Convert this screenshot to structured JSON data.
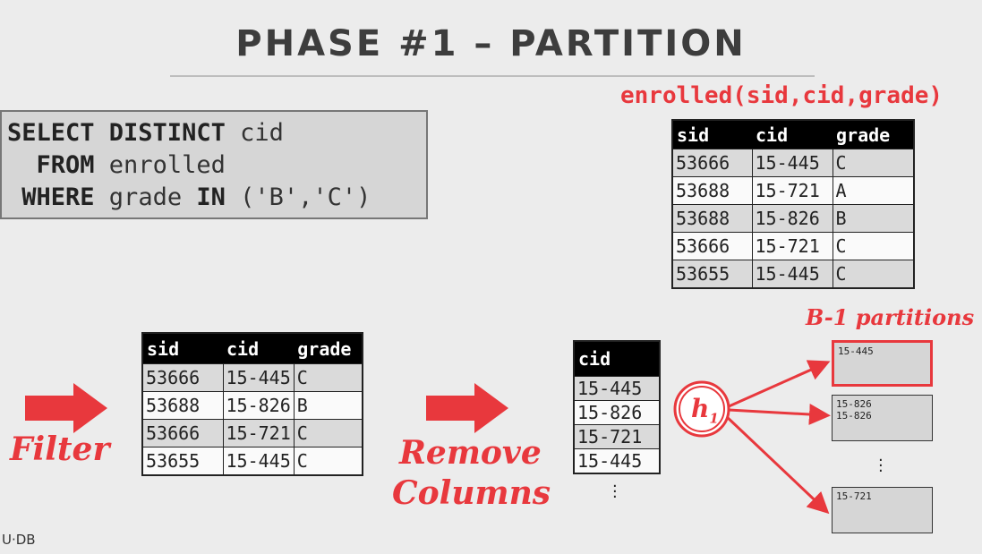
{
  "title": "PHASE #1 – PARTITION",
  "sql": {
    "line1_kw": "SELECT DISTINCT",
    "line1_rest": " cid",
    "line2_kw": "FROM",
    "line2_rest": " enrolled",
    "line3_kw": "WHERE",
    "line3_mid": " grade ",
    "line3_kw2": "IN",
    "line3_rest": " ('B','C')"
  },
  "relation_title": "enrolled(sid,cid,grade)",
  "enrolled": {
    "headers": [
      "sid",
      "cid",
      "grade"
    ],
    "rows": [
      [
        "53666",
        "15-445",
        "C"
      ],
      [
        "53688",
        "15-721",
        "A"
      ],
      [
        "53688",
        "15-826",
        "B"
      ],
      [
        "53666",
        "15-721",
        "C"
      ],
      [
        "53655",
        "15-445",
        "C"
      ]
    ]
  },
  "filter_label": "Filter",
  "filtered": {
    "headers": [
      "sid",
      "cid",
      "grade"
    ],
    "rows": [
      [
        "53666",
        "15-445",
        "C"
      ],
      [
        "53688",
        "15-826",
        "B"
      ],
      [
        "53666",
        "15-721",
        "C"
      ],
      [
        "53655",
        "15-445",
        "C"
      ]
    ]
  },
  "remove_label_1": "Remove",
  "remove_label_2": "Columns",
  "cid_table": {
    "header": "cid",
    "rows": [
      "15-445",
      "15-826",
      "15-721",
      "15-445"
    ]
  },
  "hash_label": "h",
  "hash_sub": "1",
  "partitions_label": "B-1 partitions",
  "partitions": [
    {
      "lines": [
        "15-445"
      ]
    },
    {
      "lines": [
        "15-826",
        "15-826"
      ]
    },
    {
      "lines": [
        "15-721"
      ]
    }
  ],
  "footer": "U·DB",
  "colors": {
    "accent": "#e8383d",
    "background": "#ececec"
  }
}
